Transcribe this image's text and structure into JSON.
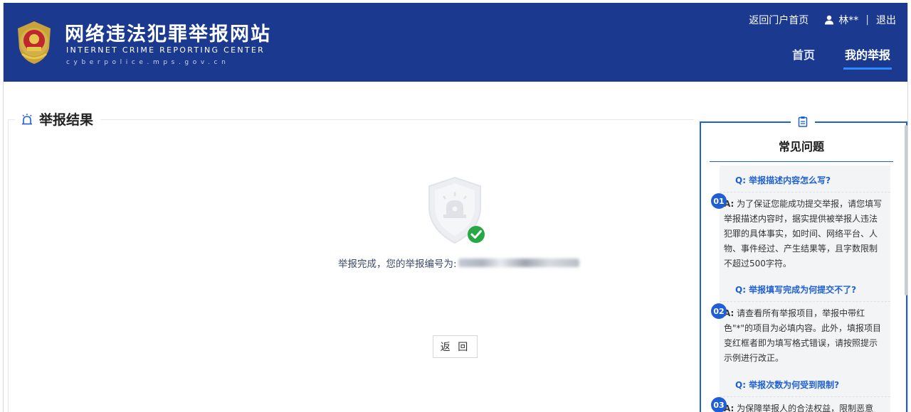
{
  "header": {
    "site_title": "网络违法犯罪举报网站",
    "site_subtitle": "INTERNET CRIME REPORTING CENTER",
    "site_domain": "cyberpolice.mps.gov.cn",
    "portal_link": "返回门户首页",
    "user_name": "林**",
    "separator": "|",
    "logout": "退出",
    "nav": [
      {
        "label": "首页",
        "active": false
      },
      {
        "label": "我的举报",
        "active": true
      }
    ]
  },
  "section": {
    "title": "举报结果"
  },
  "result": {
    "message": "举报完成，您的举报编号为: ",
    "report_id_obscured": true,
    "back_button": "返 回"
  },
  "faq": {
    "title": "常见问题",
    "items": [
      {
        "number": "01",
        "question": "Q: 举报描述内容怎么写?",
        "answer_label": "A:",
        "answer": "为了保证您能成功提交举报，请您填写举报描述内容时，据实提供被举报人违法犯罪的具体事实，如时间、网络平台、人物、事件经过、产生结果等，且字数限制不超过500字符。"
      },
      {
        "number": "02",
        "question": "Q: 举报填写完成为何提交不了?",
        "answer_label": "A:",
        "answer": "请查看所有举报项目，举报中带红色\"*\"的项目为必填内容。此外，填报项目变红框者即为填写格式错误，请按照提示示例进行改正。"
      },
      {
        "number": "03",
        "question": "Q: 举报次数为何受到限制?",
        "answer_label": "A:",
        "answer": "为保障举报人的合法权益，限制恶意"
      }
    ]
  },
  "colors": {
    "header_bg": "#1b3a8f",
    "accent": "#1f5fd6",
    "success": "#28a745"
  }
}
